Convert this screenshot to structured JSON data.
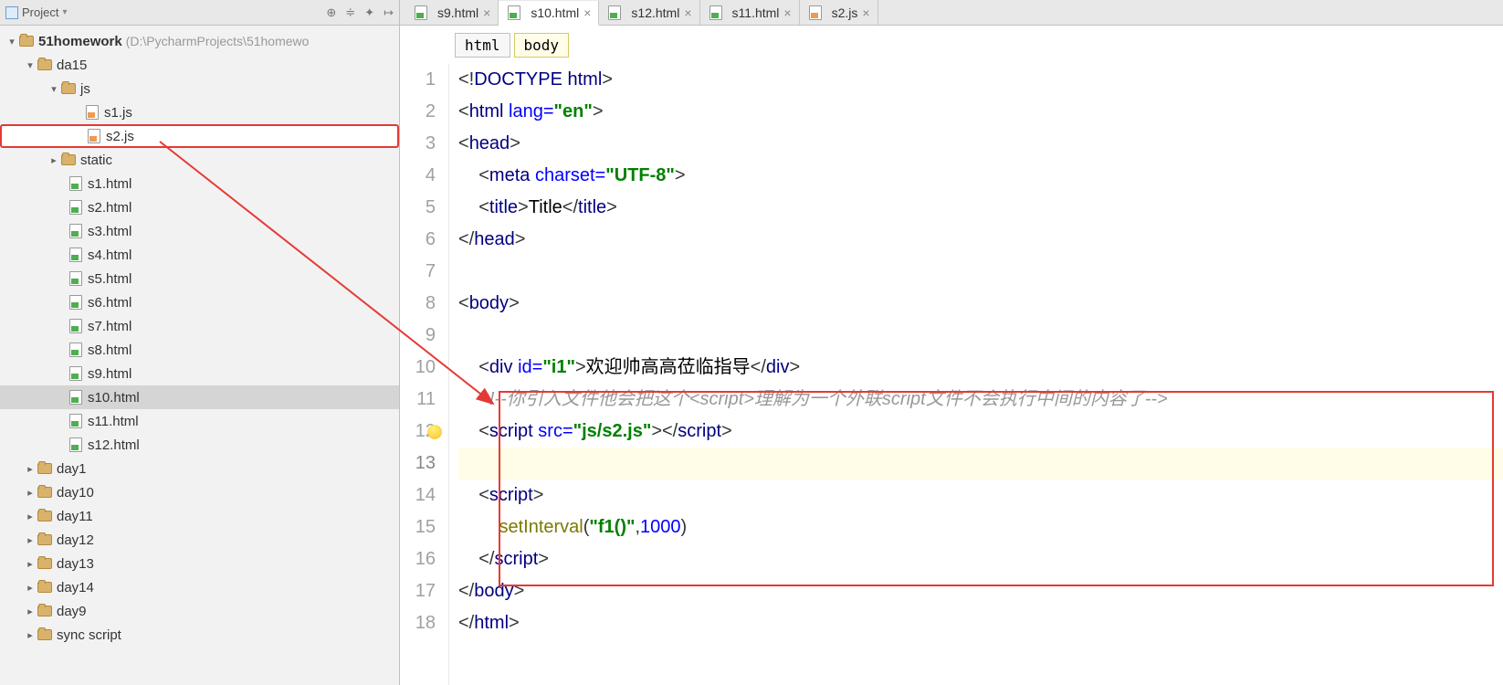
{
  "sidebar": {
    "title": "Project",
    "actions": [
      "target-icon",
      "layers-icon",
      "gear-icon",
      "collapse-icon"
    ],
    "root": {
      "name": "51homework",
      "path": "(D:\\PycharmProjects\\51homewo",
      "children": [
        {
          "name": "da15",
          "expanded": true,
          "children": [
            {
              "name": "js",
              "expanded": true,
              "children": [
                {
                  "name": "s1.js",
                  "type": "js"
                },
                {
                  "name": "s2.js",
                  "type": "js",
                  "highlighted": true
                }
              ]
            },
            {
              "name": "static",
              "expanded": false,
              "folder": true
            },
            {
              "name": "s1.html",
              "type": "html"
            },
            {
              "name": "s2.html",
              "type": "html"
            },
            {
              "name": "s3.html",
              "type": "html"
            },
            {
              "name": "s4.html",
              "type": "html"
            },
            {
              "name": "s5.html",
              "type": "html"
            },
            {
              "name": "s6.html",
              "type": "html"
            },
            {
              "name": "s7.html",
              "type": "html"
            },
            {
              "name": "s8.html",
              "type": "html"
            },
            {
              "name": "s9.html",
              "type": "html"
            },
            {
              "name": "s10.html",
              "type": "html",
              "selected": true
            },
            {
              "name": "s11.html",
              "type": "html"
            },
            {
              "name": "s12.html",
              "type": "html"
            }
          ]
        },
        {
          "name": "day1",
          "folder": true
        },
        {
          "name": "day10",
          "folder": true
        },
        {
          "name": "day11",
          "folder": true
        },
        {
          "name": "day12",
          "folder": true
        },
        {
          "name": "day13",
          "folder": true
        },
        {
          "name": "day14",
          "folder": true
        },
        {
          "name": "day9",
          "folder": true
        },
        {
          "name": "sync script",
          "folder": true
        }
      ]
    }
  },
  "tabs": [
    {
      "label": "s9.html",
      "type": "html"
    },
    {
      "label": "s10.html",
      "type": "html",
      "active": true
    },
    {
      "label": "s12.html",
      "type": "html"
    },
    {
      "label": "s11.html",
      "type": "html"
    },
    {
      "label": "s2.js",
      "type": "js"
    }
  ],
  "breadcrumb": [
    {
      "label": "html"
    },
    {
      "label": "body",
      "active": true
    }
  ],
  "code": {
    "lines": [
      {
        "n": 1,
        "html": "<span class='punct'>&lt;!</span><span class='tag'>DOCTYPE html</span><span class='punct'>&gt;</span>"
      },
      {
        "n": 2,
        "html": "<span class='punct'>&lt;</span><span class='tag'>html</span> <span class='attr'>lang=</span><span class='str'>\"en\"</span><span class='punct'>&gt;</span>",
        "fold": "open"
      },
      {
        "n": 3,
        "html": "<span class='punct'>&lt;</span><span class='tag'>head</span><span class='punct'>&gt;</span>",
        "fold": "open"
      },
      {
        "n": 4,
        "html": "    <span class='punct'>&lt;</span><span class='tag'>meta</span> <span class='attr'>charset=</span><span class='str'>\"UTF-8\"</span><span class='punct'>&gt;</span>"
      },
      {
        "n": 5,
        "html": "    <span class='punct'>&lt;</span><span class='tag'>title</span><span class='punct'>&gt;</span><span class='txt'>Title</span><span class='punct'>&lt;/</span><span class='tag'>title</span><span class='punct'>&gt;</span>"
      },
      {
        "n": 6,
        "html": "<span class='punct'>&lt;/</span><span class='tag'>head</span><span class='punct'>&gt;</span>",
        "fold": "close"
      },
      {
        "n": 7,
        "html": ""
      },
      {
        "n": 8,
        "html": "<span class='punct'>&lt;</span><span class='tag'>body</span><span class='punct'>&gt;</span>",
        "fold": "open"
      },
      {
        "n": 9,
        "html": ""
      },
      {
        "n": 10,
        "html": "    <span class='punct'>&lt;</span><span class='tag'>div</span> <span class='attr'>id=</span><span class='str'>\"i1\"</span><span class='punct'>&gt;</span><span class='txt'>欢迎帅高高莅临指导</span><span class='punct'>&lt;/</span><span class='tag'>div</span><span class='punct'>&gt;</span>"
      },
      {
        "n": 11,
        "html": "    <span class='comment'>&lt;!--你引入文件他会把这个&lt;script&gt;理解为一个外联script文件不会执行中间的内容了--&gt;</span>"
      },
      {
        "n": 12,
        "html": "    <span class='punct'>&lt;</span><span class='tag'>script</span> <span class='attr'>src=</span><span class='str'>\"js/s2.js\"</span><span class='punct'>&gt;&lt;/</span><span class='tag'>script</span><span class='punct'>&gt;</span>",
        "bulb": true
      },
      {
        "n": 13,
        "html": "",
        "current": true
      },
      {
        "n": 14,
        "html": "    <span class='punct'>&lt;</span><span class='tag'>script</span><span class='punct'>&gt;</span>",
        "fold": "open"
      },
      {
        "n": 15,
        "html": "        <span class='fn'>setInterval</span><span class='punct'>(</span><span class='str'>\"f1()\"</span><span class='punct'>,</span><span class='num'>1000</span><span class='punct'>)</span>"
      },
      {
        "n": 16,
        "html": "    <span class='punct'>&lt;/</span><span class='tag'>script</span><span class='punct'>&gt;</span>",
        "fold": "close"
      },
      {
        "n": 17,
        "html": "<span class='punct'>&lt;/</span><span class='tag'>body</span><span class='punct'>&gt;</span>",
        "fold": "close"
      },
      {
        "n": 18,
        "html": "<span class='punct'>&lt;/</span><span class='tag'>html</span><span class='punct'>&gt;</span>",
        "fold": "close"
      }
    ]
  }
}
